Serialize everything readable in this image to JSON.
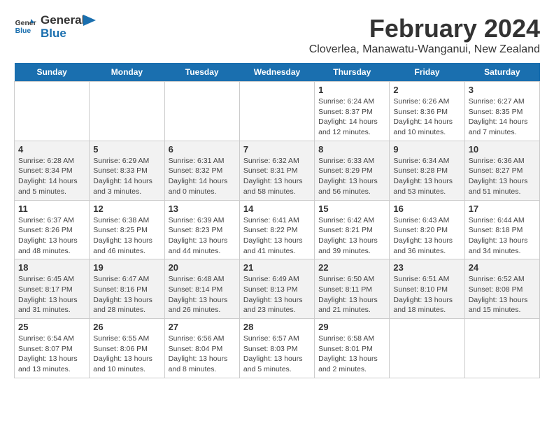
{
  "header": {
    "logo_line1": "General",
    "logo_line2": "Blue",
    "month": "February 2024",
    "location": "Cloverlea, Manawatu-Wanganui, New Zealand"
  },
  "days_of_week": [
    "Sunday",
    "Monday",
    "Tuesday",
    "Wednesday",
    "Thursday",
    "Friday",
    "Saturday"
  ],
  "weeks": [
    [
      {
        "day": "",
        "info": ""
      },
      {
        "day": "",
        "info": ""
      },
      {
        "day": "",
        "info": ""
      },
      {
        "day": "",
        "info": ""
      },
      {
        "day": "1",
        "info": "Sunrise: 6:24 AM\nSunset: 8:37 PM\nDaylight: 14 hours\nand 12 minutes."
      },
      {
        "day": "2",
        "info": "Sunrise: 6:26 AM\nSunset: 8:36 PM\nDaylight: 14 hours\nand 10 minutes."
      },
      {
        "day": "3",
        "info": "Sunrise: 6:27 AM\nSunset: 8:35 PM\nDaylight: 14 hours\nand 7 minutes."
      }
    ],
    [
      {
        "day": "4",
        "info": "Sunrise: 6:28 AM\nSunset: 8:34 PM\nDaylight: 14 hours\nand 5 minutes."
      },
      {
        "day": "5",
        "info": "Sunrise: 6:29 AM\nSunset: 8:33 PM\nDaylight: 14 hours\nand 3 minutes."
      },
      {
        "day": "6",
        "info": "Sunrise: 6:31 AM\nSunset: 8:32 PM\nDaylight: 14 hours\nand 0 minutes."
      },
      {
        "day": "7",
        "info": "Sunrise: 6:32 AM\nSunset: 8:31 PM\nDaylight: 13 hours\nand 58 minutes."
      },
      {
        "day": "8",
        "info": "Sunrise: 6:33 AM\nSunset: 8:29 PM\nDaylight: 13 hours\nand 56 minutes."
      },
      {
        "day": "9",
        "info": "Sunrise: 6:34 AM\nSunset: 8:28 PM\nDaylight: 13 hours\nand 53 minutes."
      },
      {
        "day": "10",
        "info": "Sunrise: 6:36 AM\nSunset: 8:27 PM\nDaylight: 13 hours\nand 51 minutes."
      }
    ],
    [
      {
        "day": "11",
        "info": "Sunrise: 6:37 AM\nSunset: 8:26 PM\nDaylight: 13 hours\nand 48 minutes."
      },
      {
        "day": "12",
        "info": "Sunrise: 6:38 AM\nSunset: 8:25 PM\nDaylight: 13 hours\nand 46 minutes."
      },
      {
        "day": "13",
        "info": "Sunrise: 6:39 AM\nSunset: 8:23 PM\nDaylight: 13 hours\nand 44 minutes."
      },
      {
        "day": "14",
        "info": "Sunrise: 6:41 AM\nSunset: 8:22 PM\nDaylight: 13 hours\nand 41 minutes."
      },
      {
        "day": "15",
        "info": "Sunrise: 6:42 AM\nSunset: 8:21 PM\nDaylight: 13 hours\nand 39 minutes."
      },
      {
        "day": "16",
        "info": "Sunrise: 6:43 AM\nSunset: 8:20 PM\nDaylight: 13 hours\nand 36 minutes."
      },
      {
        "day": "17",
        "info": "Sunrise: 6:44 AM\nSunset: 8:18 PM\nDaylight: 13 hours\nand 34 minutes."
      }
    ],
    [
      {
        "day": "18",
        "info": "Sunrise: 6:45 AM\nSunset: 8:17 PM\nDaylight: 13 hours\nand 31 minutes."
      },
      {
        "day": "19",
        "info": "Sunrise: 6:47 AM\nSunset: 8:16 PM\nDaylight: 13 hours\nand 28 minutes."
      },
      {
        "day": "20",
        "info": "Sunrise: 6:48 AM\nSunset: 8:14 PM\nDaylight: 13 hours\nand 26 minutes."
      },
      {
        "day": "21",
        "info": "Sunrise: 6:49 AM\nSunset: 8:13 PM\nDaylight: 13 hours\nand 23 minutes."
      },
      {
        "day": "22",
        "info": "Sunrise: 6:50 AM\nSunset: 8:11 PM\nDaylight: 13 hours\nand 21 minutes."
      },
      {
        "day": "23",
        "info": "Sunrise: 6:51 AM\nSunset: 8:10 PM\nDaylight: 13 hours\nand 18 minutes."
      },
      {
        "day": "24",
        "info": "Sunrise: 6:52 AM\nSunset: 8:08 PM\nDaylight: 13 hours\nand 15 minutes."
      }
    ],
    [
      {
        "day": "25",
        "info": "Sunrise: 6:54 AM\nSunset: 8:07 PM\nDaylight: 13 hours\nand 13 minutes."
      },
      {
        "day": "26",
        "info": "Sunrise: 6:55 AM\nSunset: 8:06 PM\nDaylight: 13 hours\nand 10 minutes."
      },
      {
        "day": "27",
        "info": "Sunrise: 6:56 AM\nSunset: 8:04 PM\nDaylight: 13 hours\nand 8 minutes."
      },
      {
        "day": "28",
        "info": "Sunrise: 6:57 AM\nSunset: 8:03 PM\nDaylight: 13 hours\nand 5 minutes."
      },
      {
        "day": "29",
        "info": "Sunrise: 6:58 AM\nSunset: 8:01 PM\nDaylight: 13 hours\nand 2 minutes."
      },
      {
        "day": "",
        "info": ""
      },
      {
        "day": "",
        "info": ""
      }
    ]
  ]
}
